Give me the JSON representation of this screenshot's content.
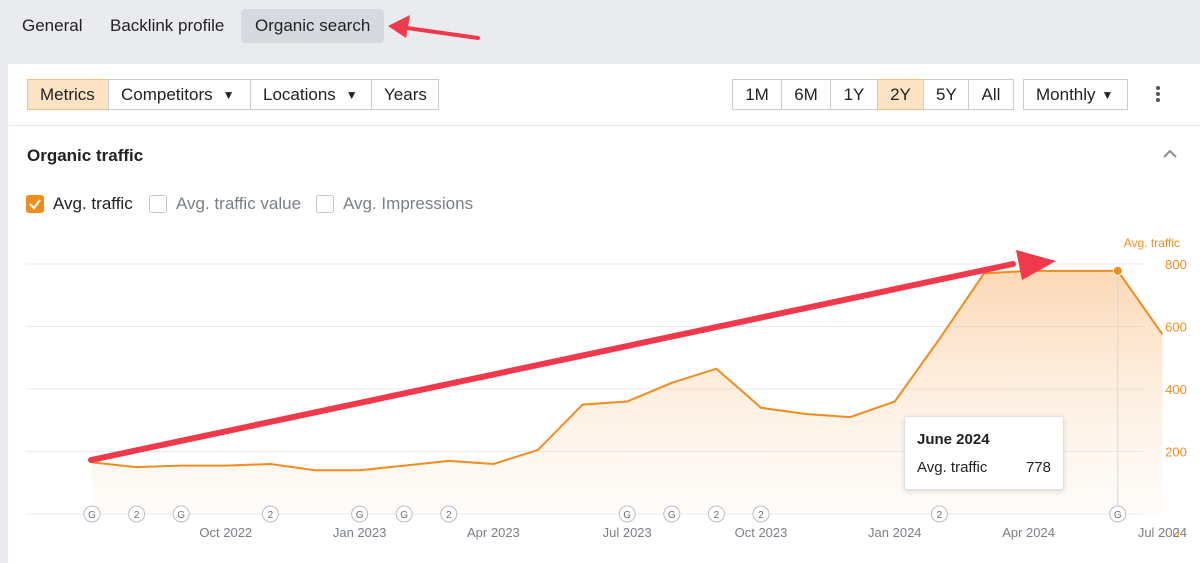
{
  "top_tabs": {
    "general": "General",
    "backlink_profile": "Backlink profile",
    "organic_search": "Organic search"
  },
  "toolbar": {
    "metrics": "Metrics",
    "competitors": "Competitors",
    "locations": "Locations",
    "years": "Years",
    "ranges": [
      "1M",
      "6M",
      "1Y",
      "2Y",
      "5Y",
      "All"
    ],
    "active_range": "2Y",
    "granularity": "Monthly"
  },
  "section": {
    "title": "Organic traffic"
  },
  "checkboxes": {
    "avg_traffic": {
      "label": "Avg. traffic",
      "checked": true
    },
    "avg_traffic_value": {
      "label": "Avg. traffic value",
      "checked": false
    },
    "avg_impressions": {
      "label": "Avg. Impressions",
      "checked": false
    }
  },
  "tooltip": {
    "title": "June 2024",
    "label": "Avg. traffic",
    "value": "778"
  },
  "colors": {
    "accent": "#f28c1e",
    "annotation_arrow": "#f0394a",
    "active_bg": "#fde3c4"
  },
  "chart_data": {
    "type": "area",
    "y_axis_title": "Avg. traffic",
    "y_ticks": [
      "0",
      "200",
      "400",
      "600",
      "800"
    ],
    "ylim": [
      0,
      860
    ],
    "x_tick_labels": [
      "Oct 2022",
      "Jan 2023",
      "Apr 2023",
      "Jul 2023",
      "Oct 2023",
      "Jan 2024",
      "Apr 2024",
      "Jul 2024"
    ],
    "months": [
      "Jul 2022",
      "Aug 2022",
      "Sep 2022",
      "Oct 2022",
      "Nov 2022",
      "Dec 2022",
      "Jan 2023",
      "Feb 2023",
      "Mar 2023",
      "Apr 2023",
      "May 2023",
      "Jun 2023",
      "Jul 2023",
      "Aug 2023",
      "Sep 2023",
      "Oct 2023",
      "Nov 2023",
      "Dec 2023",
      "Jan 2024",
      "Feb 2024",
      "Mar 2024",
      "Apr 2024",
      "May 2024",
      "Jun 2024",
      "Jul 2024"
    ],
    "series": [
      {
        "values": [
          165,
          150,
          155,
          155,
          160,
          140,
          140,
          155,
          170,
          160,
          205,
          350,
          360,
          420,
          465,
          340,
          320,
          310,
          360,
          560,
          770,
          778,
          778,
          778,
          575
        ]
      }
    ],
    "grid": true,
    "annotations": [
      {
        "month": "Jul 2022",
        "label": "G"
      },
      {
        "month": "Aug 2022",
        "label": "2"
      },
      {
        "month": "Sep 2022",
        "label": "G"
      },
      {
        "month": "Nov 2022",
        "label": "2"
      },
      {
        "month": "Jan 2023",
        "label": "G"
      },
      {
        "month": "Feb 2023",
        "label": "G"
      },
      {
        "month": "Mar 2023",
        "label": "2"
      },
      {
        "month": "Jul 2023",
        "label": "G"
      },
      {
        "month": "Aug 2023",
        "label": "G"
      },
      {
        "month": "Sep 2023",
        "label": "2"
      },
      {
        "month": "Oct 2023",
        "label": "2"
      },
      {
        "month": "Feb 2024",
        "label": "2"
      },
      {
        "month": "Jun 2024",
        "label": "G"
      }
    ],
    "highlight_month": "Jun 2024"
  }
}
